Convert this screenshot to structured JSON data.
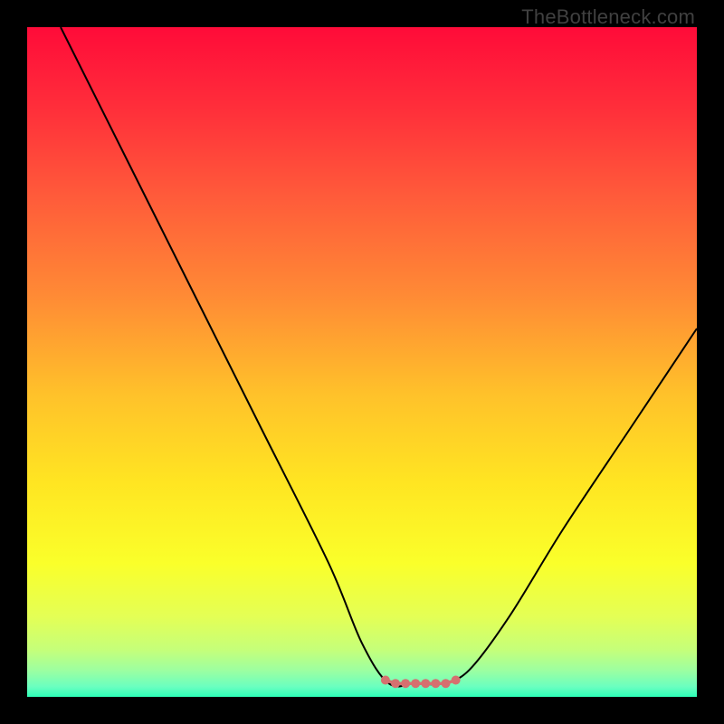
{
  "watermark": "TheBottleneck.com",
  "chart_data": {
    "type": "line",
    "title": "",
    "xlabel": "",
    "ylabel": "",
    "x_range": [
      0,
      100
    ],
    "y_range": [
      0,
      100
    ],
    "background_gradient": {
      "direction": "vertical",
      "stops": [
        {
          "pos": 0.0,
          "color": "#ff0b39"
        },
        {
          "pos": 0.12,
          "color": "#ff2e3a"
        },
        {
          "pos": 0.25,
          "color": "#ff5a3a"
        },
        {
          "pos": 0.4,
          "color": "#ff8a35"
        },
        {
          "pos": 0.55,
          "color": "#ffc22a"
        },
        {
          "pos": 0.68,
          "color": "#ffe522"
        },
        {
          "pos": 0.8,
          "color": "#faff2a"
        },
        {
          "pos": 0.88,
          "color": "#e4ff55"
        },
        {
          "pos": 0.93,
          "color": "#c5ff7a"
        },
        {
          "pos": 0.96,
          "color": "#9dffa0"
        },
        {
          "pos": 0.985,
          "color": "#6affc0"
        },
        {
          "pos": 1.0,
          "color": "#2dffb8"
        }
      ]
    },
    "series": [
      {
        "name": "bottleneck-curve",
        "color": "#000000",
        "width": 2,
        "points": [
          {
            "x": 5,
            "y": 100
          },
          {
            "x": 15,
            "y": 80
          },
          {
            "x": 25,
            "y": 60
          },
          {
            "x": 35,
            "y": 40
          },
          {
            "x": 45,
            "y": 20
          },
          {
            "x": 50,
            "y": 8
          },
          {
            "x": 54,
            "y": 2
          },
          {
            "x": 58,
            "y": 2
          },
          {
            "x": 62,
            "y": 2
          },
          {
            "x": 66,
            "y": 4
          },
          {
            "x": 72,
            "y": 12
          },
          {
            "x": 80,
            "y": 25
          },
          {
            "x": 90,
            "y": 40
          },
          {
            "x": 100,
            "y": 55
          }
        ]
      }
    ],
    "markers": {
      "name": "flat-zone-markers",
      "color": "#d6706f",
      "radius": 5,
      "stroke_width": 3.5,
      "points": [
        {
          "x": 53.5,
          "y": 2.5
        },
        {
          "x": 55.0,
          "y": 2.0
        },
        {
          "x": 56.5,
          "y": 2.0
        },
        {
          "x": 58.0,
          "y": 2.0
        },
        {
          "x": 59.5,
          "y": 2.0
        },
        {
          "x": 61.0,
          "y": 2.0
        },
        {
          "x": 62.5,
          "y": 2.0
        },
        {
          "x": 64.0,
          "y": 2.5
        }
      ],
      "connector": true
    }
  }
}
